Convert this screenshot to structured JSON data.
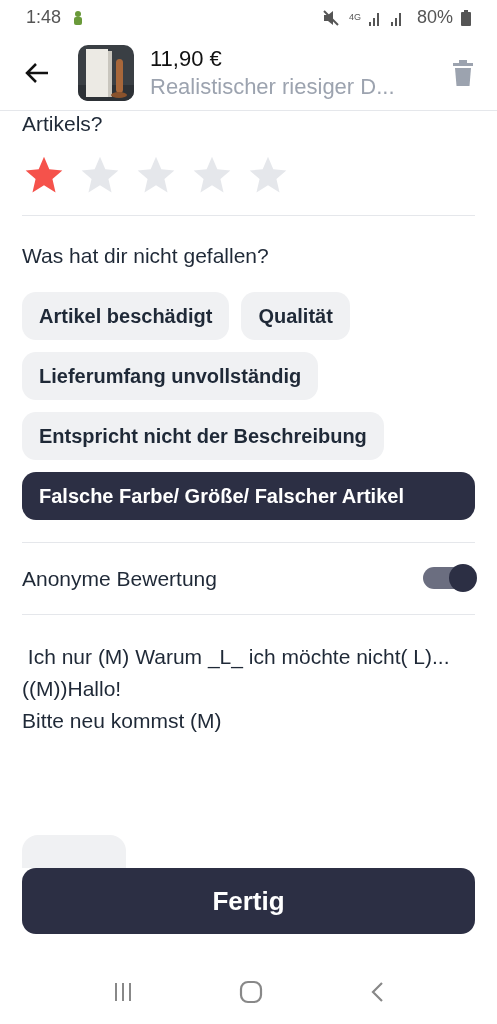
{
  "status_bar": {
    "time": "1:48",
    "battery": "80%",
    "network": "4G"
  },
  "header": {
    "price": "11,90 €",
    "title": "Realistischer riesiger D..."
  },
  "rating": {
    "question": "Artikels?",
    "stars": 1
  },
  "dislikes": {
    "question": "Was hat dir nicht gefallen?",
    "options": [
      {
        "label": "Artikel beschädigt",
        "selected": false
      },
      {
        "label": "Qualität",
        "selected": false
      },
      {
        "label": "Lieferumfang unvollständig",
        "selected": false
      },
      {
        "label": "Entspricht nicht der Beschreibung",
        "selected": false
      },
      {
        "label": "Falsche Farbe/ Größe/ Falscher Artikel",
        "selected": true
      }
    ]
  },
  "anonymous": {
    "label": "Anonyme Bewertung",
    "on": true
  },
  "comment": {
    "value": " Ich nur (M) Warum _L_ ich möchte nicht( L)... ((M))Hallo!\nBitte neu kommst (M)"
  },
  "done_button": "Fertig"
}
